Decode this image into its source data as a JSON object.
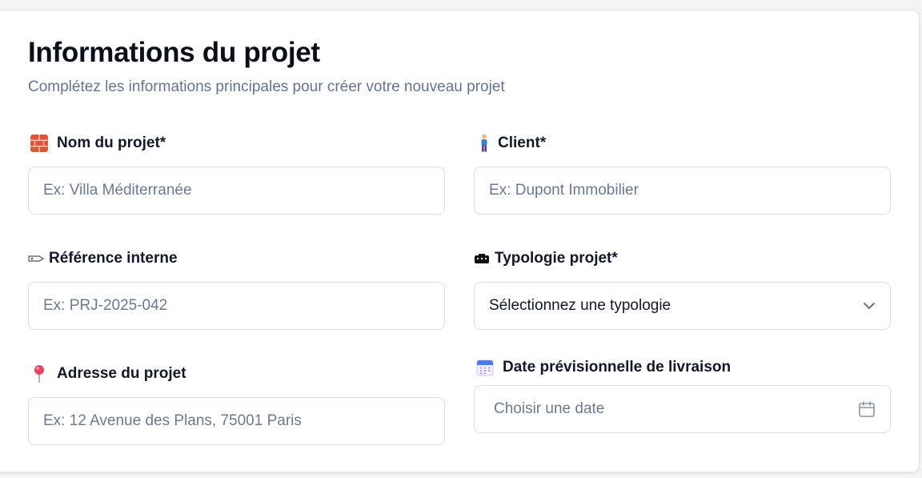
{
  "header": {
    "title": "Informations du projet",
    "subtitle": "Complétez les informations principales pour créer votre nouveau projet"
  },
  "fields": {
    "nom": {
      "label": "Nom du projet*",
      "placeholder": "Ex: Villa Méditerranée",
      "icon": "brick-icon"
    },
    "client": {
      "label": "Client*",
      "placeholder": "Ex: Dupont Immobilier",
      "icon": "person-icon"
    },
    "reference": {
      "label": "Référence interne",
      "placeholder": "Ex: PRJ-2025-042",
      "icon": "tag-icon"
    },
    "typologie": {
      "label": "Typologie projet*",
      "value": "Sélectionnez une typologie",
      "icon": "building-icon"
    },
    "adresse": {
      "label": "Adresse du projet",
      "placeholder": "Ex: 12 Avenue des Plans, 75001 Paris",
      "icon": "pin-icon"
    },
    "date": {
      "label": "Date prévisionnelle de livraison",
      "placeholder": "Choisir une date",
      "icon": "calendar-icon"
    }
  },
  "colors": {
    "title": "#0b0f1a",
    "subtitle": "#64748b",
    "placeholder": "#6b7a90",
    "border": "#d9dee5"
  }
}
